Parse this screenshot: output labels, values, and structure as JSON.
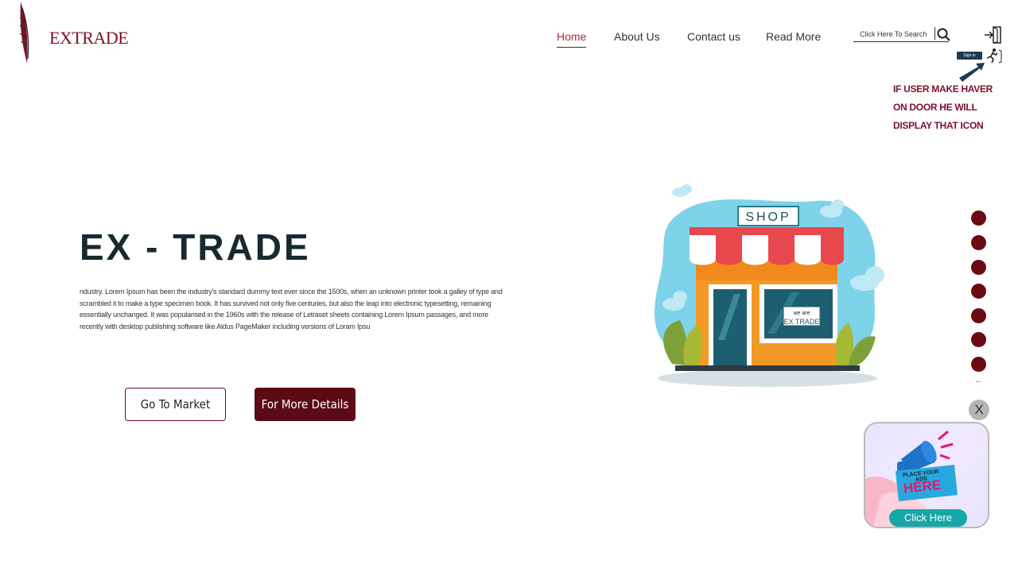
{
  "logo": {
    "text": "EXTRADE"
  },
  "nav": {
    "items": [
      {
        "label": "Home",
        "active": true
      },
      {
        "label": "About Us"
      },
      {
        "label": "Contact us"
      },
      {
        "label": "Read More"
      }
    ]
  },
  "search": {
    "placeholder": "Click Here To Search"
  },
  "signin": {
    "tooltip": "Sign in"
  },
  "annotation": {
    "text": "IF USER MAKE HAVER ON DOOR HE WILL DISPLAY THAT ICON"
  },
  "hero": {
    "title": "EX - TRADE",
    "description": "ndustry. Lorem Ipsum has been the industry's standard dummy text ever since the 1500s, when an unknown printer took a galley of type and scrambled it to make a type specimen book. It has survived not only five centuries, but also the leap into electronic typesetting, remaining essentially unchanged. It was popularised in the 1960s with the release of Letraset sheets containing Lorem Ipsum passages, and more recently with desktop publishing software like Aldus PageMaker including versions of Loram Ipsu",
    "market_button": "Go To Market",
    "details_button": "For More Details"
  },
  "illustration": {
    "sign": "SHOP",
    "window_line1": "we are",
    "window_line2": "EX TRADE"
  },
  "pager": {
    "count": 7
  },
  "ad": {
    "close_label": "X",
    "tagline": "PLACE YOUR ADS",
    "here": "HERE",
    "button": "Click Here"
  },
  "colors": {
    "brand": "#5b0b15",
    "accent": "#b2263c",
    "dot": "#6b0a12",
    "teal": "#16a7a7"
  }
}
